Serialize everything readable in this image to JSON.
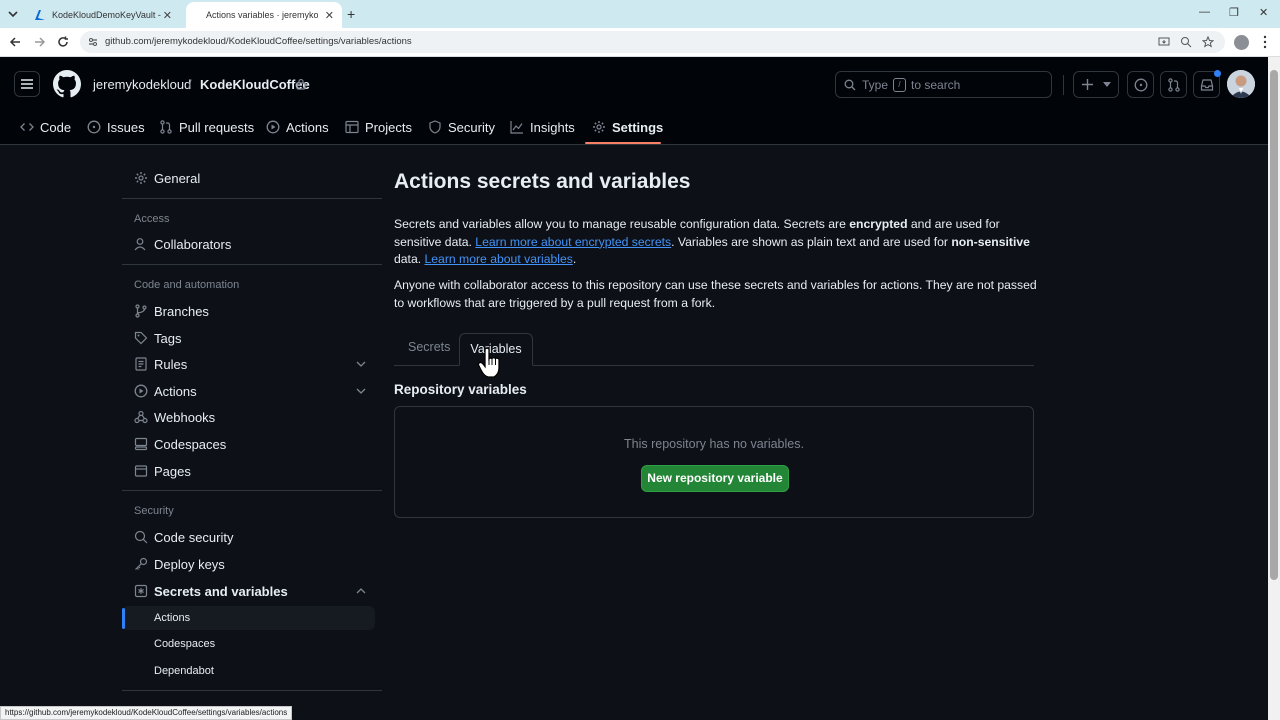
{
  "browser": {
    "tabs": [
      {
        "title": "KodeKloudDemoKeyVault - Mic",
        "active": false
      },
      {
        "title": "Actions variables · jeremykodeklou",
        "active": true
      }
    ],
    "url": "github.com/jeremykodekloud/KodeKloudCoffee/settings/variables/actions",
    "status_url": "https://github.com/jeremykodekloud/KodeKloudCoffee/settings/variables/actions"
  },
  "header": {
    "owner": "jeremykodekloud",
    "separator": "/",
    "repo": "KodeKloudCoffee",
    "search": {
      "prefix": "Type",
      "key": "/",
      "suffix": "to search"
    }
  },
  "repo_nav": {
    "code": "Code",
    "issues": "Issues",
    "pull_requests": "Pull requests",
    "actions": "Actions",
    "projects": "Projects",
    "security": "Security",
    "insights": "Insights",
    "settings": "Settings"
  },
  "sidebar": {
    "general": "General",
    "access_heading": "Access",
    "collaborators": "Collaborators",
    "code_automation_heading": "Code and automation",
    "branches": "Branches",
    "tags": "Tags",
    "rules": "Rules",
    "actions": "Actions",
    "webhooks": "Webhooks",
    "codespaces": "Codespaces",
    "pages": "Pages",
    "security_heading": "Security",
    "code_security": "Code security",
    "deploy_keys": "Deploy keys",
    "secrets_and_variables": "Secrets and variables",
    "sub": {
      "actions": "Actions",
      "codespaces": "Codespaces",
      "dependabot": "Dependabot"
    }
  },
  "main": {
    "title": "Actions secrets and variables",
    "intro": {
      "t1": "Secrets and variables allow you to manage reusable configuration data. Secrets are ",
      "b1": "encrypted",
      "t2": " and are used for sensitive data. ",
      "link1": "Learn more about encrypted secrets",
      "t3": ". Variables are shown as plain text and are used for ",
      "b2": "non-sensitive",
      "t4": " data. ",
      "link2": "Learn more about variables",
      "t5": "."
    },
    "note": "Anyone with collaborator access to this repository can use these secrets and variables for actions. They are not passed to workflows that are triggered by a pull request from a fork.",
    "tabs": {
      "secrets": "Secrets",
      "variables": "Variables"
    },
    "section_title": "Repository variables",
    "empty_text": "This repository has no variables.",
    "new_button": "New repository variable"
  },
  "colors": {
    "accent_green": "#238636",
    "link_blue": "#4493f8",
    "nav_underline": "#f78166",
    "bg": "#0d1117"
  }
}
